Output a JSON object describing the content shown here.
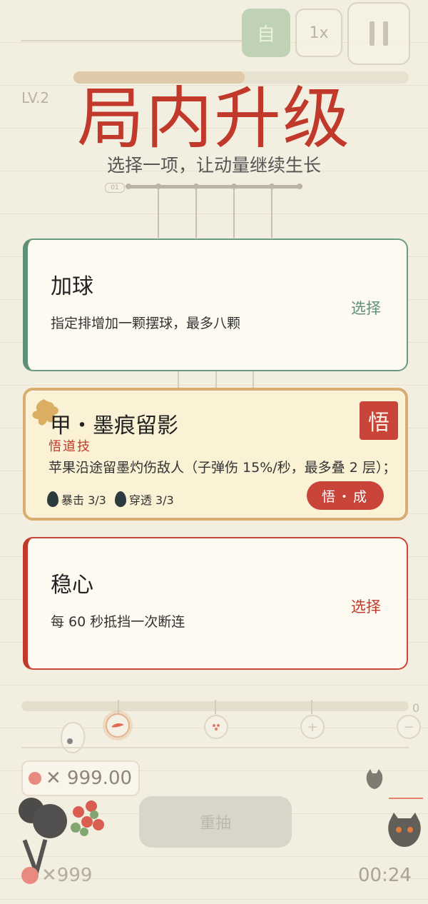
{
  "hud": {
    "auto_label": "自",
    "speed_label": "1x",
    "level": "LV.2",
    "progress": 0.51,
    "branch_tag": "01"
  },
  "header": {
    "title": "局内升级",
    "subtitle": "选择一项，让动量继续生长"
  },
  "cards": [
    {
      "name": "加球",
      "desc": "指定排增加一颗摆球，最多八颗",
      "action": "选择",
      "accent": "#5f8f74"
    },
    {
      "name": "甲・墨痕留影",
      "subtitle": "悟道技",
      "desc": "苹果沿途留墨灼伤敌人（子弹伤 15%/秒，最多叠 2 层）；",
      "badge": "悟",
      "action": "悟・成",
      "tags": [
        {
          "label": "暴击 3/3"
        },
        {
          "label": "穿透 3/3"
        }
      ],
      "accent": "#c9453a"
    },
    {
      "name": "稳心",
      "desc": "每 60 秒抵挡一次断连",
      "action": "选择",
      "accent": "#c0392b"
    }
  ],
  "timeline": {
    "end_label": "0",
    "icons": [
      "brush-icon",
      "dots-icon",
      "plus-icon",
      "minus-icon"
    ]
  },
  "footer": {
    "money": "✕ 999.00",
    "reroll_label": "重抽",
    "lives": "✕999",
    "timer": "00:24"
  }
}
